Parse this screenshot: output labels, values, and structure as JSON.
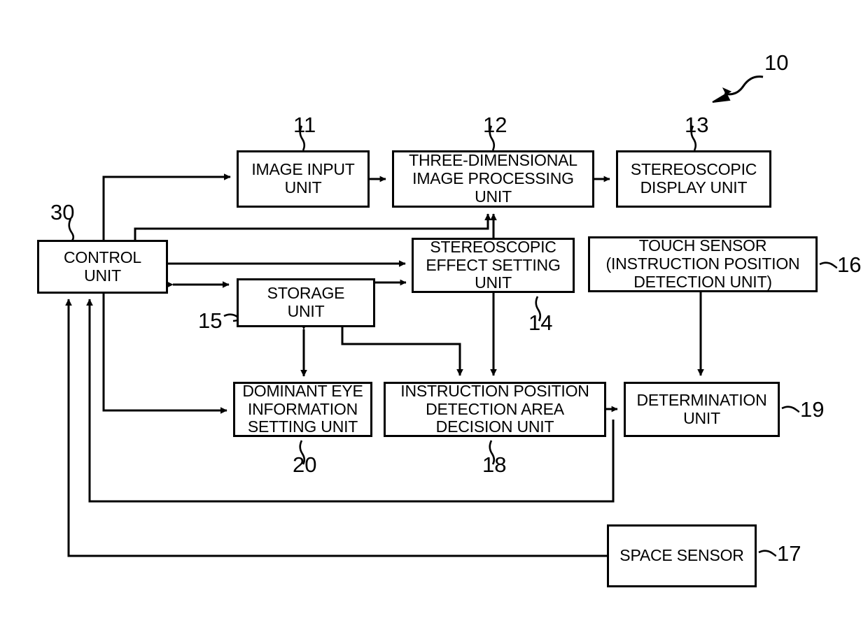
{
  "figure": {
    "type": "patent-block-diagram",
    "background_color": "#ffffff",
    "line_color": "#000000",
    "system_reference": "10"
  },
  "blocks": [
    {
      "id": "image_input",
      "label": "IMAGE INPUT\nUNIT",
      "ref": "11"
    },
    {
      "id": "three_d_processing",
      "label": "THREE-DIMENSIONAL\nIMAGE PROCESSING\nUNIT",
      "ref": "12"
    },
    {
      "id": "stereo_display",
      "label": "STEREOSCOPIC\nDISPLAY UNIT",
      "ref": "13"
    },
    {
      "id": "control",
      "label": "CONTROL\nUNIT",
      "ref": "30"
    },
    {
      "id": "stereo_effect",
      "label": "STEREOSCOPIC\nEFFECT SETTING\nUNIT",
      "ref": "14"
    },
    {
      "id": "storage",
      "label": "STORAGE\nUNIT",
      "ref": "15"
    },
    {
      "id": "touch_sensor",
      "label": "TOUCH SENSOR\n(INSTRUCTION POSITION\nDETECTION UNIT)",
      "ref": "16"
    },
    {
      "id": "dominant_eye",
      "label": "DOMINANT EYE\nINFORMATION\nSETTING UNIT",
      "ref": "20"
    },
    {
      "id": "instruction_area",
      "label": "INSTRUCTION POSITION\nDETECTION AREA\nDECISION UNIT",
      "ref": "18"
    },
    {
      "id": "determination",
      "label": "DETERMINATION\nUNIT",
      "ref": "19"
    },
    {
      "id": "space_sensor",
      "label": "SPACE SENSOR",
      "ref": "17"
    }
  ],
  "reference_numbers": {
    "system": "10",
    "image_input": "11",
    "three_d_processing": "12",
    "stereo_display": "13",
    "stereo_effect": "14",
    "storage": "15",
    "touch_sensor": "16",
    "space_sensor": "17",
    "instruction_area": "18",
    "determination": "19",
    "dominant_eye": "20",
    "control": "30"
  }
}
